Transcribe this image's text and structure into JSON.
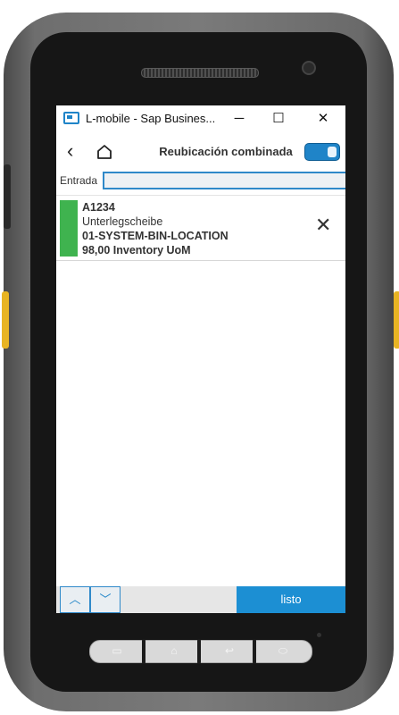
{
  "window": {
    "title": "L-mobile - Sap Busines...",
    "minimize_glyph": "─",
    "maximize_glyph": "☐",
    "close_glyph": "✕"
  },
  "header": {
    "back_glyph": "‹",
    "title": "Reubicación combinada",
    "toggle_state": "on"
  },
  "entry": {
    "label": "Entrada",
    "value": ""
  },
  "items": [
    {
      "code": "A1234",
      "description": "Unterlegscheibe",
      "location": "01-SYSTEM-BIN-LOCATION",
      "quantity": "98,00 Inventory UoM",
      "status_color": "#3fb34f"
    }
  ],
  "footer": {
    "up_glyph": "︿",
    "down_glyph": "﹀",
    "done_label": "listo"
  },
  "colors": {
    "accent": "#1c8fd3",
    "status_ok": "#3fb34f"
  },
  "icons": [
    "app-icon",
    "back-icon",
    "home-icon",
    "toggle-icon",
    "close-icon",
    "chevron-up-icon",
    "chevron-down-icon"
  ]
}
